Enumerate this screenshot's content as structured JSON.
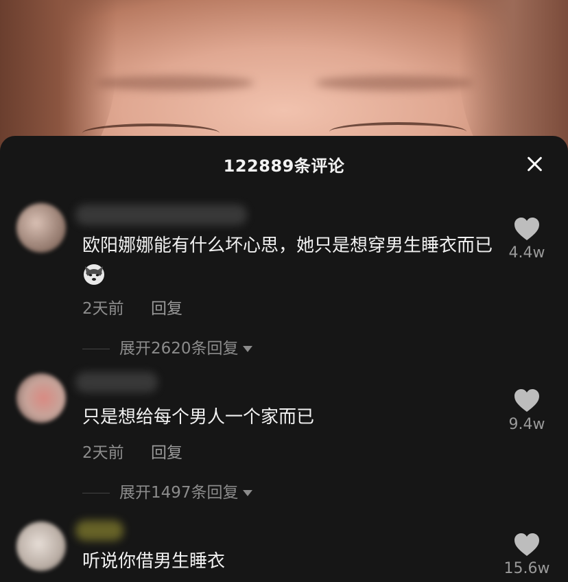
{
  "header": {
    "title": "122889条评论",
    "close_icon": "close-icon"
  },
  "comments": [
    {
      "text": "欧阳娜娜能有什么坏心思，她只是想穿男生睡衣而已",
      "emoji": "husky-dog-emoji",
      "time": "2天前",
      "reply_label": "回复",
      "expand_label": "展开2620条回复",
      "likes": "4.4w"
    },
    {
      "text": "只是想给每个男人一个家而已",
      "time": "2天前",
      "reply_label": "回复",
      "expand_label": "展开1497条回复",
      "likes": "9.4w"
    },
    {
      "text": "听说你借男生睡衣",
      "likes": "15.6w"
    }
  ],
  "colors": {
    "panel_bg": "#161616",
    "text_primary": "#f1f1f1",
    "text_secondary": "#8c8c8c",
    "like_icon": "#bdbdbd"
  }
}
